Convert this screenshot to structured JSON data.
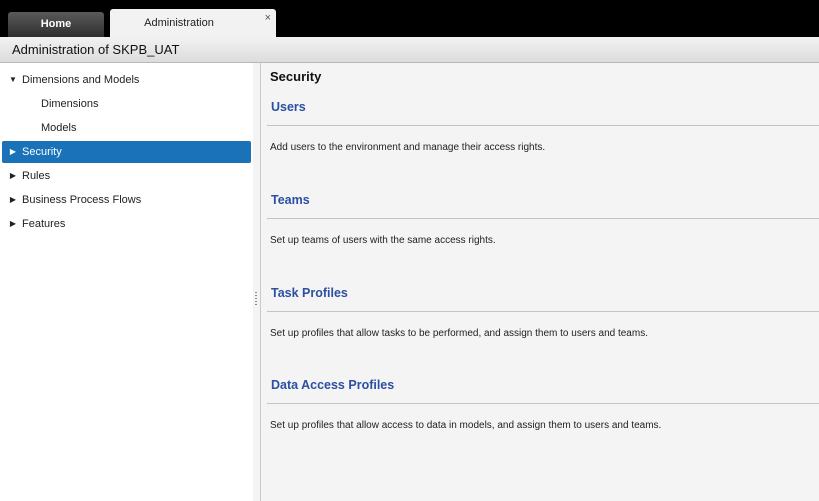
{
  "tabs": {
    "home": "Home",
    "admin": "Administration",
    "close_glyph": "×"
  },
  "title": "Administration of SKPB_UAT",
  "sidebar": {
    "items": [
      {
        "label": "Dimensions and Models",
        "arrow": "▼"
      },
      {
        "label": "Dimensions"
      },
      {
        "label": "Models"
      },
      {
        "label": "Security",
        "arrow": "▶",
        "selected": true
      },
      {
        "label": "Rules",
        "arrow": "▶"
      },
      {
        "label": "Business Process Flows",
        "arrow": "▶"
      },
      {
        "label": "Features",
        "arrow": "▶"
      }
    ]
  },
  "main": {
    "title": "Security",
    "sections": [
      {
        "title": "Users",
        "desc": "Add users to the environment and manage their access rights."
      },
      {
        "title": "Teams",
        "desc": "Set up teams of users with the same access rights."
      },
      {
        "title": "Task Profiles",
        "desc": "Set up profiles that allow tasks to be performed, and assign them to users and teams."
      },
      {
        "title": "Data Access Profiles",
        "desc": "Set up profiles that allow access to data in models, and assign them to users and teams."
      }
    ]
  },
  "colors": {
    "selected": "#1a73b8",
    "link": "#2c4fa3"
  }
}
